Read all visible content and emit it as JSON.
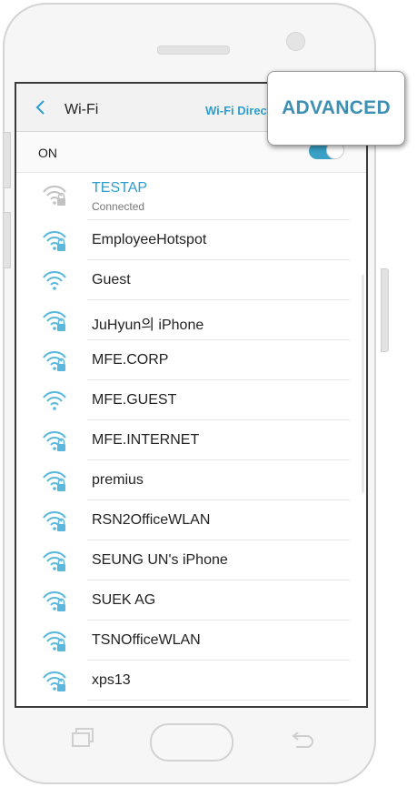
{
  "header": {
    "back_icon": "chevron-left-icon",
    "title": "Wi-Fi",
    "wifi_direct_label": "Wi-Fi Direct",
    "advanced_label": "ADVANCED"
  },
  "toggle": {
    "label": "ON",
    "state": "on",
    "accent_color": "#3aa0c6"
  },
  "networks": [
    {
      "name": "TESTAP",
      "status": "Connected",
      "secured": true
    },
    {
      "name": "EmployeeHotspot",
      "secured": true
    },
    {
      "name": "Guest",
      "secured": false
    },
    {
      "name": "JuHyun의 iPhone",
      "secured": true
    },
    {
      "name": "MFE.CORP",
      "secured": true
    },
    {
      "name": "MFE.GUEST",
      "secured": false
    },
    {
      "name": "MFE.INTERNET",
      "secured": true
    },
    {
      "name": "premius",
      "secured": true
    },
    {
      "name": "RSN2OfficeWLAN",
      "secured": true
    },
    {
      "name": "SEUNG UN's iPhone",
      "secured": true
    },
    {
      "name": "SUEK AG",
      "secured": true
    },
    {
      "name": "TSNOfficeWLAN",
      "secured": true
    },
    {
      "name": "xps13",
      "secured": true
    }
  ],
  "nav": {
    "recent_icon": "recent-apps-icon",
    "home": "home-button",
    "back_icon": "back-arrow-icon"
  },
  "colors": {
    "accent": "#2e9ed0",
    "wifi_icon": "#5bb8dd",
    "connected_icon": "#c2c2c2"
  }
}
